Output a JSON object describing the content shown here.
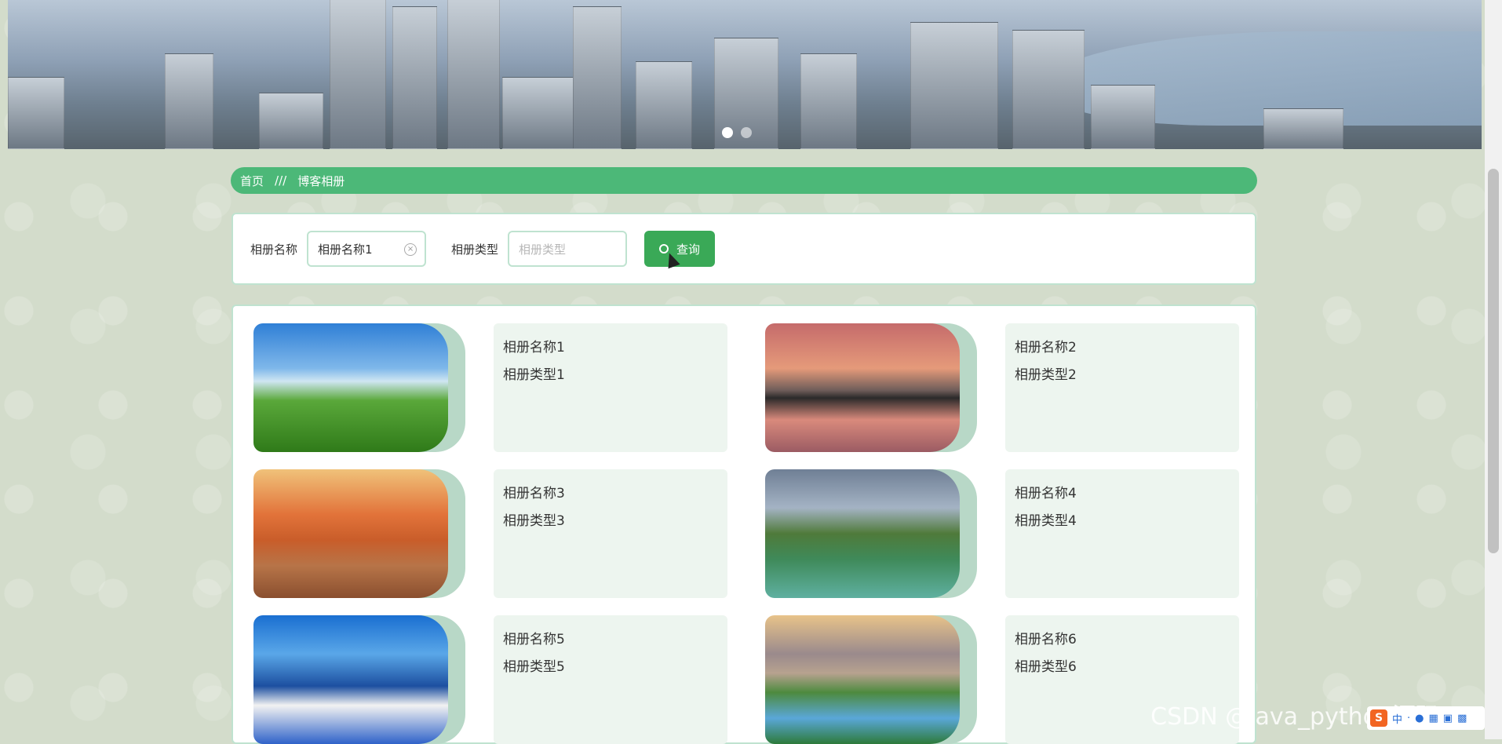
{
  "breadcrumb": {
    "home": "首页",
    "separator": "///",
    "current": "博客相册"
  },
  "search": {
    "name_label": "相册名称",
    "name_value": "相册名称1",
    "type_label": "相册类型",
    "type_placeholder": "相册类型",
    "button_label": "查询",
    "button_icon": "search-icon",
    "clear_icon": "clear-icon"
  },
  "albums": [
    {
      "name": "相册名称1",
      "type": "相册类型1"
    },
    {
      "name": "相册名称2",
      "type": "相册类型2"
    },
    {
      "name": "相册名称3",
      "type": "相册类型3"
    },
    {
      "name": "相册名称4",
      "type": "相册类型4"
    },
    {
      "name": "相册名称5",
      "type": "相册类型5"
    },
    {
      "name": "相册名称6",
      "type": "相册类型6"
    }
  ],
  "carousel": {
    "slides": 2,
    "active": 1
  },
  "watermark": "CSDN @java_python源码",
  "ime": {
    "logo": "S",
    "mode": "中"
  },
  "colors": {
    "accent": "#4cb878",
    "button": "#3aa957",
    "card_bg": "#edf5ef",
    "border": "#bfe3d0"
  }
}
